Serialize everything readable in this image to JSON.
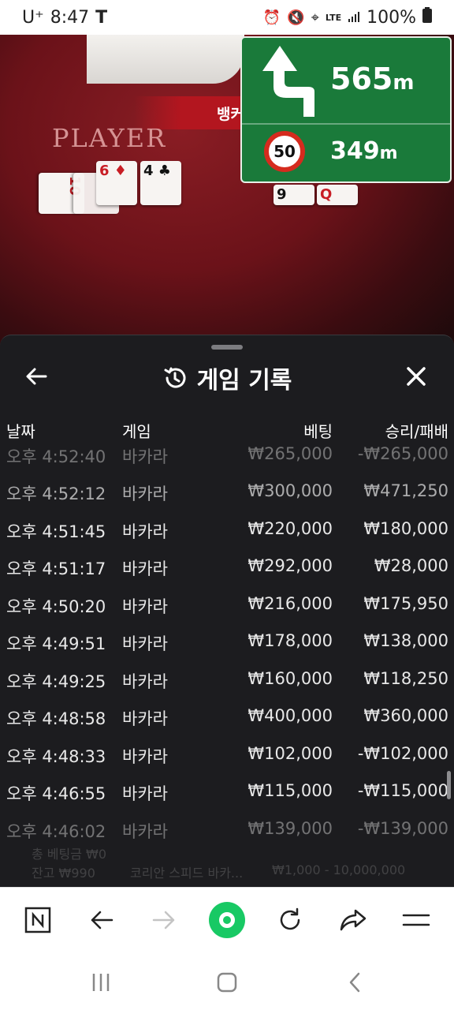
{
  "status_bar": {
    "carrier": "U⁺",
    "time": "8:47",
    "t_icon": "T",
    "lte": "LTE",
    "battery_percent": "100%"
  },
  "game": {
    "player_label": "PLAYER",
    "banker_banner": "뱅커",
    "player_cards": [
      "10",
      "10",
      "6",
      "4"
    ],
    "banker_cards": [
      "9",
      "Q"
    ]
  },
  "navigation": {
    "distance_value": "565",
    "distance_unit": "m",
    "speed_limit": "50",
    "limit_distance_value": "349",
    "limit_distance_unit": "m",
    "sign_color": "#1a7a3a"
  },
  "history_sheet": {
    "title": "게임 기록",
    "columns": {
      "date": "날짜",
      "game": "게임",
      "bet": "베팅",
      "win_loss": "승리/패배"
    },
    "rows": [
      {
        "time": "오후 4:52:40",
        "game": "바카라",
        "bet": "₩265,000",
        "result": "-₩265,000"
      },
      {
        "time": "오후 4:52:12",
        "game": "바카라",
        "bet": "₩300,000",
        "result": "₩471,250"
      },
      {
        "time": "오후 4:51:45",
        "game": "바카라",
        "bet": "₩220,000",
        "result": "₩180,000"
      },
      {
        "time": "오후 4:51:17",
        "game": "바카라",
        "bet": "₩292,000",
        "result": "₩28,000"
      },
      {
        "time": "오후 4:50:20",
        "game": "바카라",
        "bet": "₩216,000",
        "result": "₩175,950"
      },
      {
        "time": "오후 4:49:51",
        "game": "바카라",
        "bet": "₩178,000",
        "result": "₩138,000"
      },
      {
        "time": "오후 4:49:25",
        "game": "바카라",
        "bet": "₩160,000",
        "result": "₩118,250"
      },
      {
        "time": "오후 4:48:58",
        "game": "바카라",
        "bet": "₩400,000",
        "result": "₩360,000"
      },
      {
        "time": "오후 4:48:33",
        "game": "바카라",
        "bet": "₩102,000",
        "result": "-₩102,000"
      },
      {
        "time": "오후 4:46:55",
        "game": "바카라",
        "bet": "₩115,000",
        "result": "-₩115,000"
      },
      {
        "time": "오후 4:46:02",
        "game": "바카라",
        "bet": "₩139,000",
        "result": "-₩139,000"
      }
    ]
  },
  "underlay": {
    "total_bet": "총 베팅금 ₩0",
    "balance": "잔고 ₩990",
    "table_name": "코리안 스피드 바카...",
    "limits": "₩1,000 - 10,000,000"
  },
  "browser_toolbar": {
    "items": [
      "naver-n",
      "back",
      "forward",
      "home",
      "refresh",
      "share",
      "menu"
    ]
  },
  "colors": {
    "accent_green": "#18c964",
    "sheet_bg": "#1c1c1f",
    "banner_red": "#b3161f"
  }
}
